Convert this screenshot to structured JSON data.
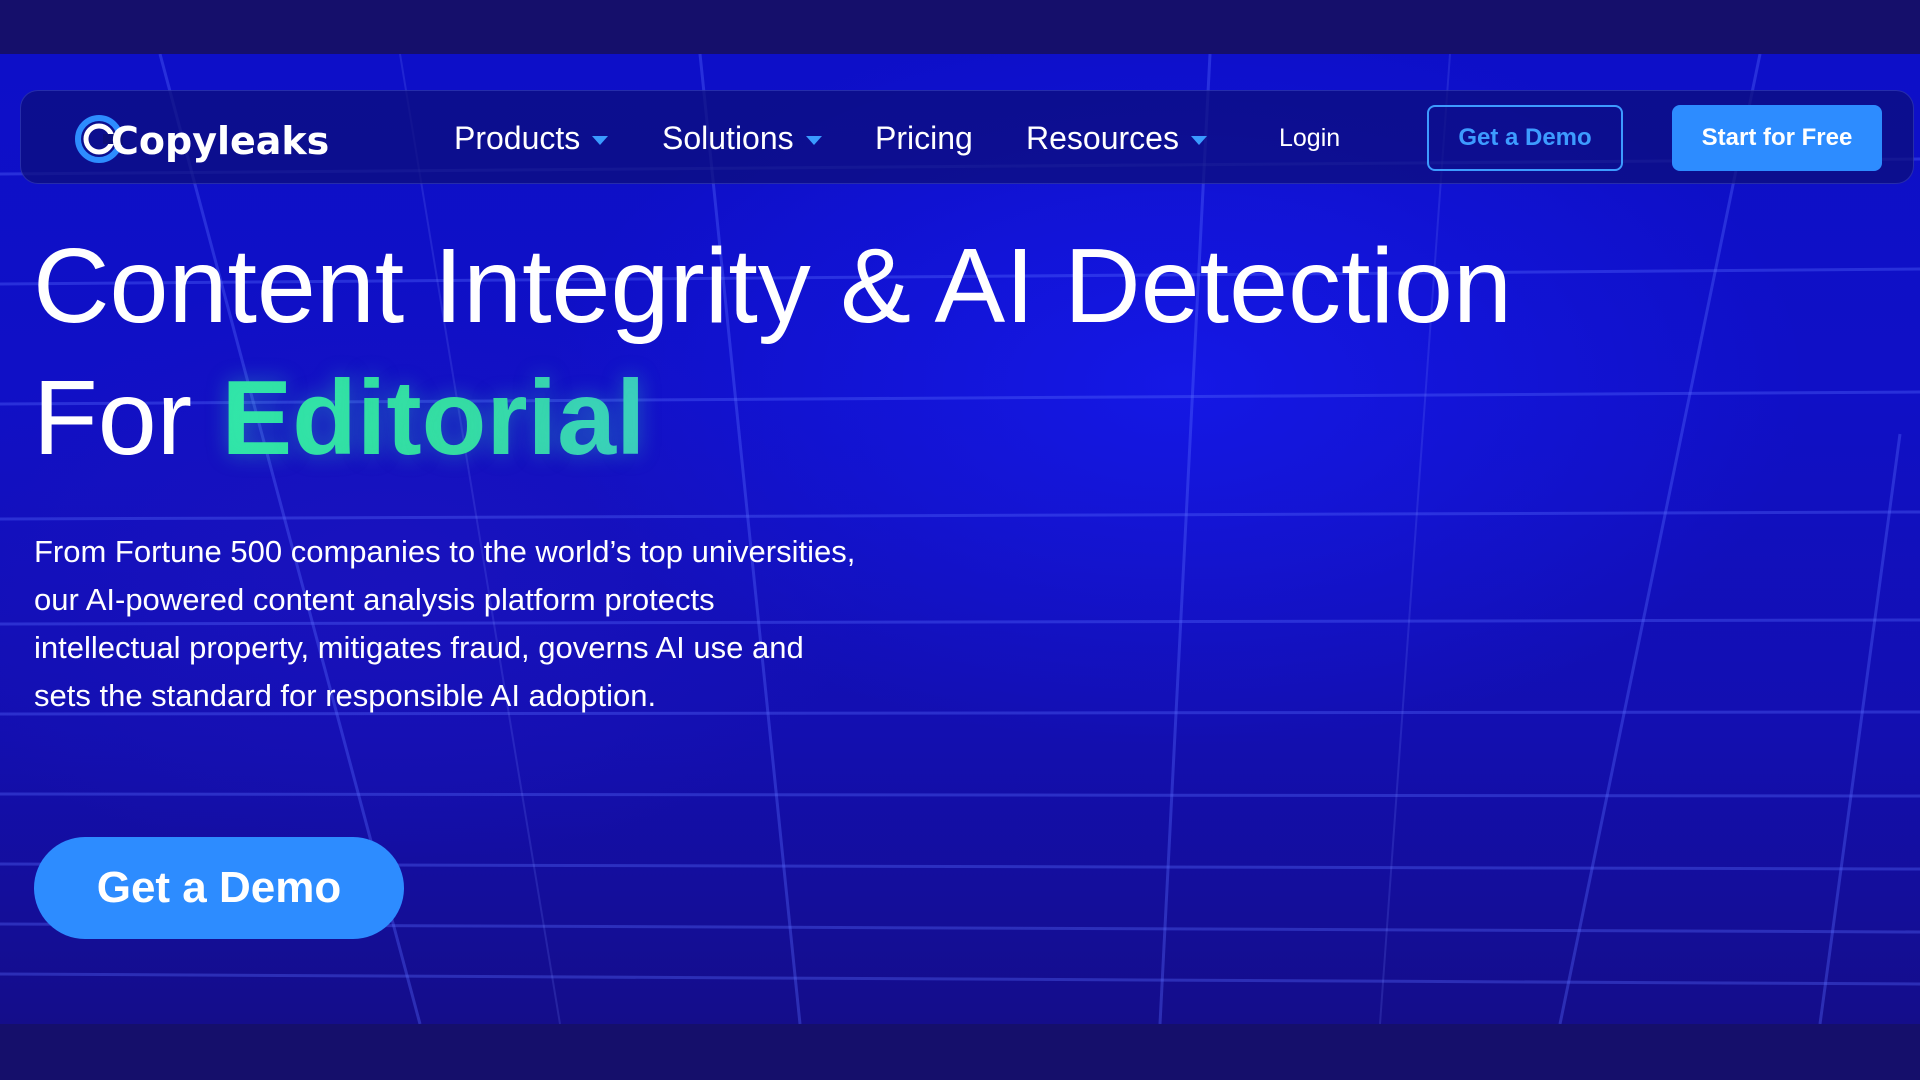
{
  "brand": {
    "name": "Copyleaks",
    "logo_icon": "copyleaks-c-icon",
    "colors": {
      "accent_blue": "#2d8cff",
      "accent_green": "#2fe3a6",
      "background": "#1010c6"
    }
  },
  "nav": {
    "items": [
      {
        "label": "Products",
        "has_dropdown": true
      },
      {
        "label": "Solutions",
        "has_dropdown": true
      },
      {
        "label": "Pricing",
        "has_dropdown": false
      },
      {
        "label": "Resources",
        "has_dropdown": true
      }
    ],
    "login_label": "Login",
    "demo_label": "Get a Demo",
    "start_label": "Start for Free"
  },
  "hero": {
    "title_line1": "Content Integrity & AI Detection",
    "title_line2_prefix": "For",
    "title_line2_accent": "Editorial",
    "description": "From Fortune 500 companies to the world’s top universities, our AI-powered content analysis platform protects intellectual property, mitigates fraud, governs AI use and sets the standard for responsible AI adoption.",
    "cta_label": "Get a Demo"
  }
}
